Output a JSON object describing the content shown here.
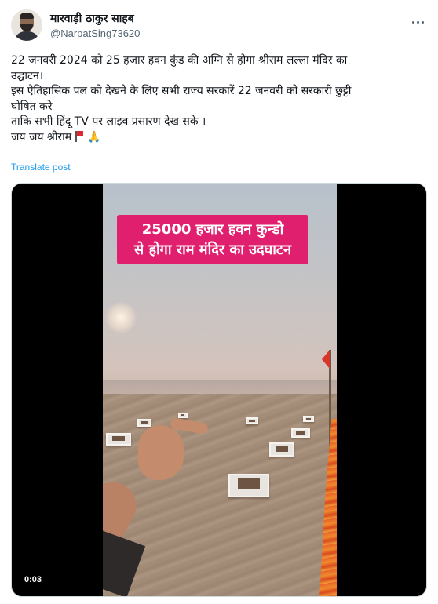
{
  "author": {
    "display_name": "मारवाड़ी ठाकुर साहब",
    "handle": "@NarpatSing73620",
    "avatar_icon": "user-avatar-icon"
  },
  "more_icon": "more-options-icon",
  "post": {
    "lines": [
      "22 जनवरी 2024 को 25 हजार हवन कुंड की अग्नि से होगा श्रीराम लल्ला मंदिर का",
      "उद्घाटन।",
      "इस ऐतिहासिक पल को देखने के लिए सभी राज्य सरकारें 22 जनवरी को सरकारी छुट्टी",
      "घोषित करे",
      "ताकि सभी हिंदू TV पर लाइव प्रसारण देख सके ।",
      "जय जय श्रीराम"
    ],
    "emojis": [
      "triangular-flag-icon",
      "folded-hands-icon"
    ],
    "translate_label": "Translate post"
  },
  "video": {
    "banner_line1": "25000  हजार हवन कुन्डो",
    "banner_line2": "से होगा राम मंदिर का उदघाटन",
    "timestamp": "0:03"
  },
  "colors": {
    "text": "#0f1419",
    "secondary": "#536471",
    "link": "#1d9bf0",
    "banner": "#e0206e"
  }
}
